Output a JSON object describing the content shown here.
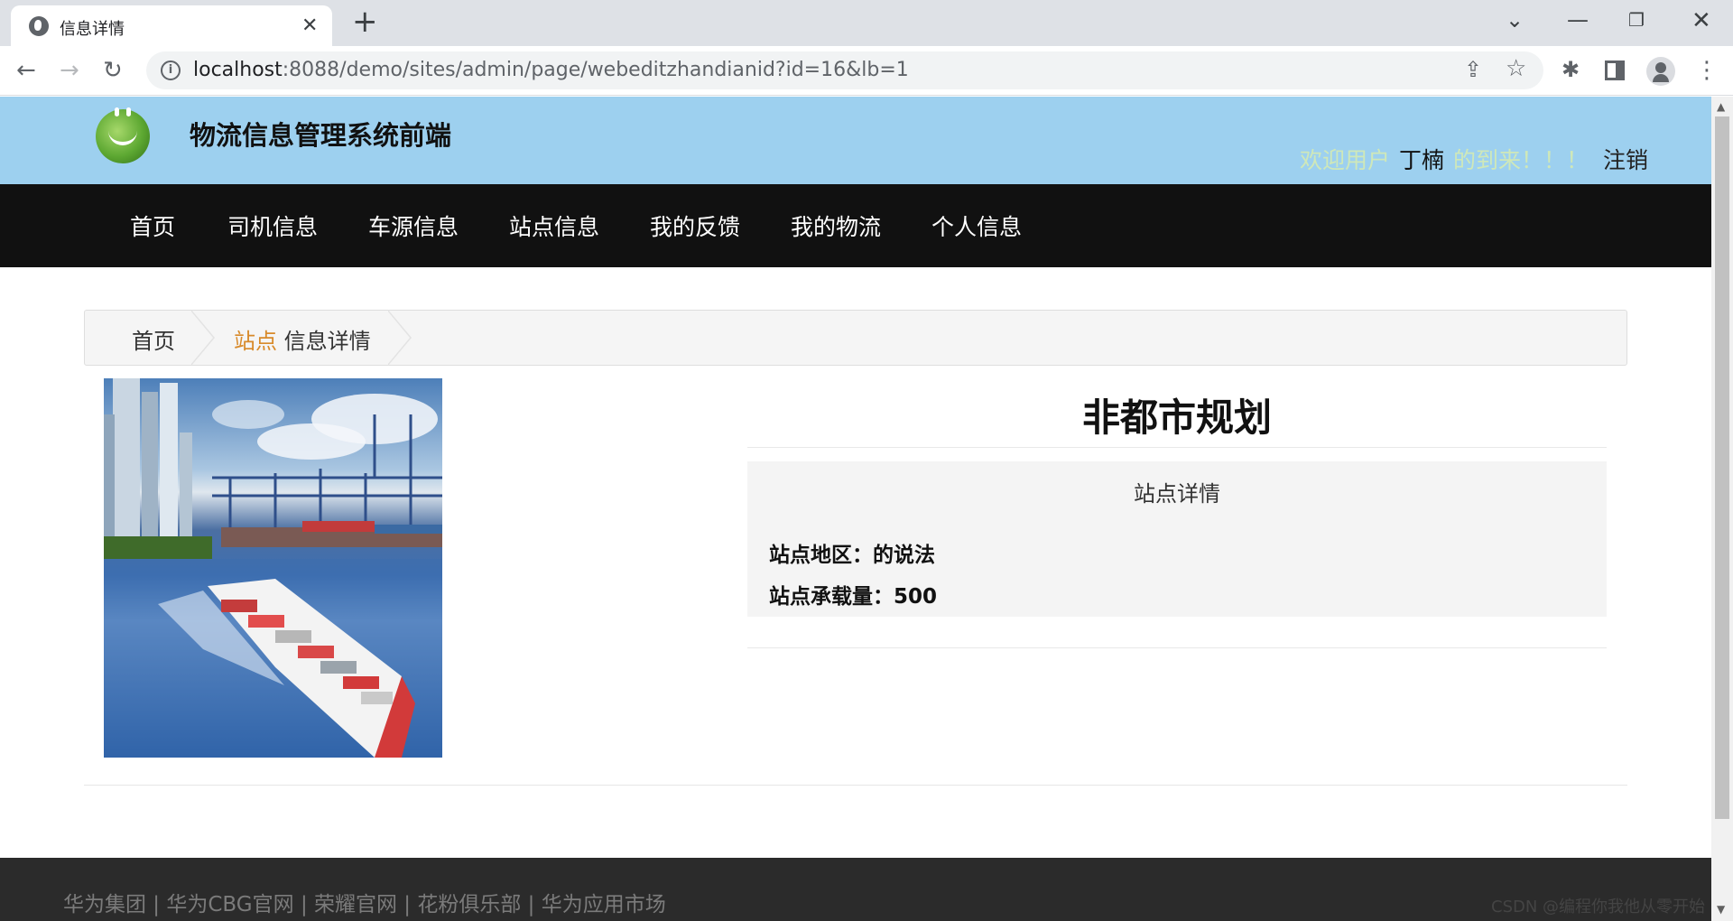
{
  "browser": {
    "tab_title": "信息详情",
    "url_host": "localhost",
    "url_rest": ":8088/demo/sites/admin/page/webeditzhandianid?id=16&lb=1"
  },
  "site": {
    "title": "物流信息管理系统前端",
    "welcome_prefix": "欢迎用户",
    "username": "丁楠",
    "welcome_suffix": "的到来！！！",
    "logout": "注销"
  },
  "nav": {
    "items": [
      "首页",
      "司机信息",
      "车源信息",
      "站点信息",
      "我的反馈",
      "我的物流",
      "个人信息"
    ]
  },
  "breadcrumb": {
    "home": "首页",
    "category": "站点",
    "current": "信息详情"
  },
  "detail": {
    "title": "非都市规划",
    "subtitle": "站点详情",
    "fields": [
      "站点地区：的说法",
      "站点承载量：500"
    ]
  },
  "footer": {
    "links": "华为集团 | 华为CBG官网 | 荣耀官网 | 花粉俱乐部 | 华为应用市场"
  },
  "watermark": "CSDN @编程你我他从零开始"
}
